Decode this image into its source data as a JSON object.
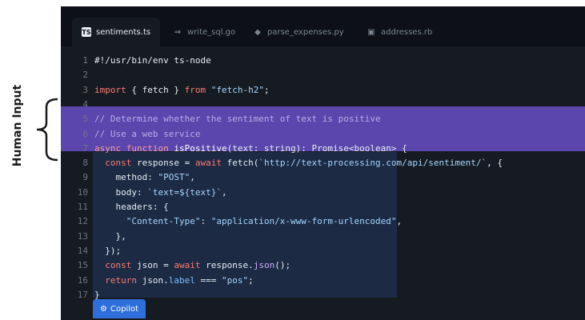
{
  "annotation": {
    "label": "Human Input"
  },
  "tabs": [
    {
      "label": "sentiments.ts",
      "icon": "typescript-icon",
      "active": true
    },
    {
      "label": "write_sql.go",
      "icon": "go-icon",
      "active": false
    },
    {
      "label": "parse_expenses.py",
      "icon": "python-icon",
      "active": false
    },
    {
      "label": "addresses.rb",
      "icon": "ruby-icon",
      "active": false
    }
  ],
  "code": {
    "lines": [
      {
        "n": "1",
        "parts": [
          [
            "plain",
            "#!/usr/bin/env ts-node"
          ]
        ]
      },
      {
        "n": "2",
        "parts": []
      },
      {
        "n": "3",
        "parts": [
          [
            "kw",
            "import"
          ],
          [
            "plain",
            " { fetch } "
          ],
          [
            "kw",
            "from"
          ],
          [
            "str",
            " \"fetch-h2\""
          ],
          [
            "plain",
            ";"
          ]
        ]
      },
      {
        "n": "4",
        "parts": []
      },
      {
        "n": "5",
        "parts": [
          [
            "cm",
            "// Determine whether the sentiment of text is positive"
          ]
        ]
      },
      {
        "n": "6",
        "parts": [
          [
            "cm",
            "// Use a web service"
          ]
        ]
      },
      {
        "n": "7",
        "parts": [
          [
            "kw",
            "async function "
          ],
          [
            "fn",
            "isPositive"
          ],
          [
            "plain",
            "(text: string): Promise<boolean> {"
          ]
        ]
      },
      {
        "n": "8",
        "parts": [
          [
            "kw",
            "  const"
          ],
          [
            "plain",
            " response = "
          ],
          [
            "kw",
            "await"
          ],
          [
            "plain",
            " fetch("
          ],
          [
            "str",
            "`http://text-processing.com/api/sentiment/`"
          ],
          [
            "plain",
            ", {"
          ]
        ]
      },
      {
        "n": "9",
        "parts": [
          [
            "plain",
            "    method: "
          ],
          [
            "str",
            "\"POST\""
          ],
          [
            "plain",
            ","
          ]
        ]
      },
      {
        "n": "10",
        "parts": [
          [
            "plain",
            "    body: "
          ],
          [
            "str",
            "`text=${text}`"
          ],
          [
            "plain",
            ","
          ]
        ]
      },
      {
        "n": "11",
        "parts": [
          [
            "plain",
            "    headers: {"
          ]
        ]
      },
      {
        "n": "12",
        "parts": [
          [
            "str",
            "      \"Content-Type\""
          ],
          [
            "plain",
            ": "
          ],
          [
            "str",
            "\"application/x-www-form-urlencoded\""
          ],
          [
            "plain",
            ","
          ]
        ]
      },
      {
        "n": "13",
        "parts": [
          [
            "plain",
            "    },"
          ]
        ]
      },
      {
        "n": "14",
        "parts": [
          [
            "plain",
            "  });"
          ]
        ]
      },
      {
        "n": "15",
        "parts": [
          [
            "kw",
            "  const"
          ],
          [
            "plain",
            " json = "
          ],
          [
            "kw",
            "await"
          ],
          [
            "plain",
            " response."
          ],
          [
            "fn",
            "json"
          ],
          [
            "plain",
            "();"
          ]
        ]
      },
      {
        "n": "16",
        "parts": [
          [
            "kw",
            "  return"
          ],
          [
            "plain",
            " json."
          ],
          [
            "prop",
            "label"
          ],
          [
            "plain",
            " === "
          ],
          [
            "str",
            "\"pos\""
          ],
          [
            "plain",
            ";"
          ]
        ]
      },
      {
        "n": "17",
        "parts": [
          [
            "plain",
            "}"
          ]
        ]
      }
    ]
  },
  "copilot": {
    "label": "Copilot",
    "icon": "copilot-icon"
  },
  "colors": {
    "highlight": "#5a46ad",
    "suggestion": "#1c2a44",
    "copilot": "#2f6fdb"
  }
}
